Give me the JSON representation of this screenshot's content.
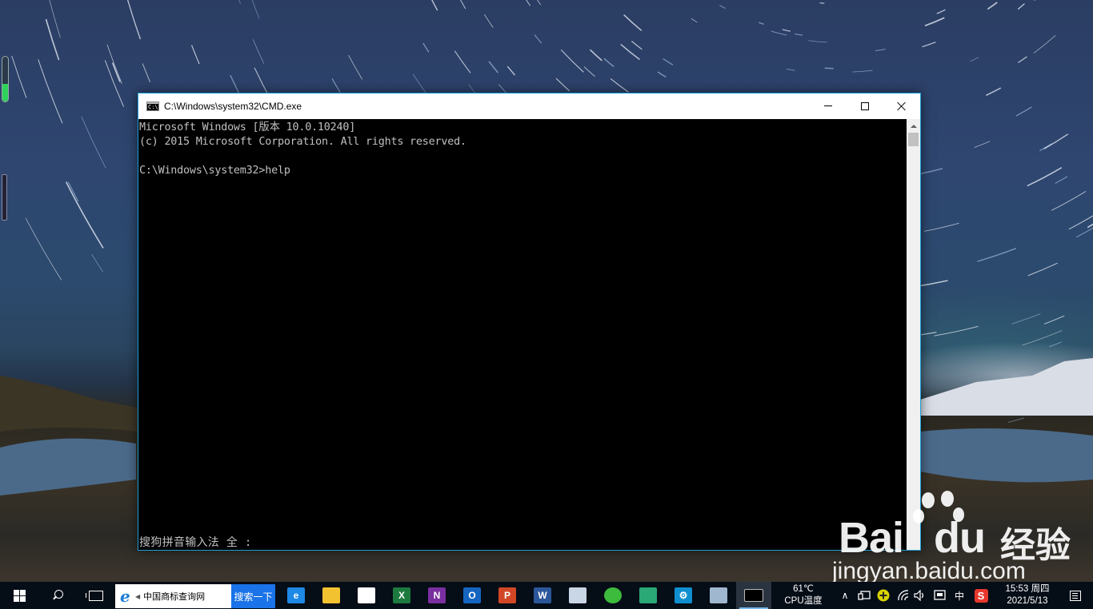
{
  "window": {
    "title": "C:\\Windows\\system32\\CMD.exe",
    "icon": "cmd-icon",
    "icon_text": "C:\\"
  },
  "console": {
    "lines": [
      "Microsoft Windows [版本 10.0.10240]",
      "(c) 2015 Microsoft Corporation. All rights reserved.",
      "",
      "C:\\Windows\\system32>help"
    ],
    "ime_status": "搜狗拼音输入法 全 :"
  },
  "desktop": {
    "gadget_level": 0.4
  },
  "watermark": {
    "brand": "Bai",
    "brand2": "du",
    "cn": "经验",
    "url": "jingyan.baidu.com"
  },
  "taskbar": {
    "search_box": {
      "value": "中国商标查询网",
      "button_label": "搜索一下"
    },
    "apps": [
      {
        "name": "edge-icon",
        "label": "e",
        "color": "#1e88e5"
      },
      {
        "name": "file-explorer-icon",
        "label": "",
        "color": "#f2c230"
      },
      {
        "name": "store-icon",
        "label": "",
        "color": "#ffffff"
      },
      {
        "name": "excel-icon",
        "label": "X",
        "color": "#1d7a3e"
      },
      {
        "name": "onenote-icon",
        "label": "N",
        "color": "#7a2fa0"
      },
      {
        "name": "outlook-icon",
        "label": "O",
        "color": "#1565c0"
      },
      {
        "name": "powerpoint-icon",
        "label": "P",
        "color": "#d24726"
      },
      {
        "name": "word-icon",
        "label": "W",
        "color": "#2b579a"
      },
      {
        "name": "paint-icon",
        "label": "",
        "color": "#c8d6e5"
      },
      {
        "name": "browser-360-icon",
        "label": "",
        "color": "#3dbb3d"
      },
      {
        "name": "photos-icon",
        "label": "",
        "color": "#2aa876"
      },
      {
        "name": "settings-icon",
        "label": "⚙",
        "color": "#0f8fcf"
      },
      {
        "name": "control-panel-icon",
        "label": "",
        "color": "#9fb8cf"
      },
      {
        "name": "cmd-taskbar-icon",
        "label": "",
        "color": "#000000"
      }
    ],
    "temperature": "61℃",
    "temperature_label": "CPU温度",
    "tray": {
      "chevron": "∧",
      "ime": "中",
      "sogou": "S"
    },
    "clock": {
      "time": "15:53 周四",
      "date": "2021/5/13"
    }
  }
}
